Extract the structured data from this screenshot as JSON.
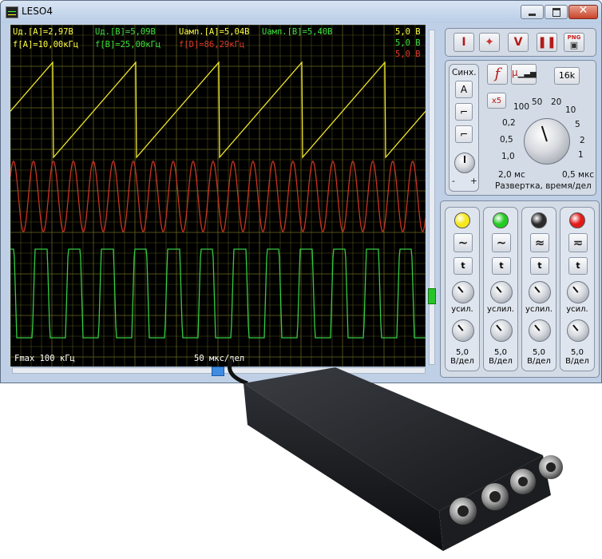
{
  "window": {
    "title": "LESO4"
  },
  "scope": {
    "readouts": {
      "ud_a": "Uд.[A]=2,97В",
      "ud_b": "Uд.[B]=5,09В",
      "uamp_a": "Uамп.[A]=5,04В",
      "uamp_b": "Uамп.[B]=5,40В",
      "f_a": "f[A]=10,00кГц",
      "f_b": "f[B]=25,00кГц",
      "f_d": "f[D]=86,29кГц"
    },
    "scales": [
      "5,0 В",
      "5,0 В",
      "5,0 В"
    ],
    "fmax": "Fmax 100 кГц",
    "timebase": "50 мкс/дел"
  },
  "toolbar": {
    "i": "I",
    "v": "V",
    "png": "PNG"
  },
  "sync": {
    "title": "Синх.",
    "channel": "A",
    "minus": "-",
    "plus": "+"
  },
  "sweep": {
    "f_label": "f",
    "mu_label": "μ",
    "memory": "16k",
    "x5": "x5",
    "scale_100": "100",
    "scale_50": "50",
    "scale_20": "20",
    "scale_10": "10",
    "scale_02": "0,2",
    "scale_5": "5",
    "scale_05": "0,5",
    "scale_2": "2",
    "scale_10b": "1,0",
    "scale_1": "1",
    "min": "2,0 мс",
    "max": "0,5 мкс",
    "caption": "Развертка, время/дел"
  },
  "channels": [
    {
      "color": "#f6e81c",
      "gain": "усил.",
      "value": "5,0",
      "unit": "В/дел",
      "t": "t"
    },
    {
      "color": "#22cc22",
      "gain": "услил.",
      "value": "5,0",
      "unit": "В/дел",
      "t": "t"
    },
    {
      "color": "#2b2b2b",
      "gain": "услил.",
      "value": "5,0",
      "unit": "В/дел",
      "t": "t"
    },
    {
      "color": "#e21a1a",
      "gain": "усил.",
      "value": "5,0",
      "unit": "В/дел",
      "t": "t"
    }
  ],
  "colors": {
    "trace_a": "#f0e62a",
    "trace_b": "#c93322",
    "trace_d": "#33cc44",
    "grid": "#5a5a1c"
  }
}
